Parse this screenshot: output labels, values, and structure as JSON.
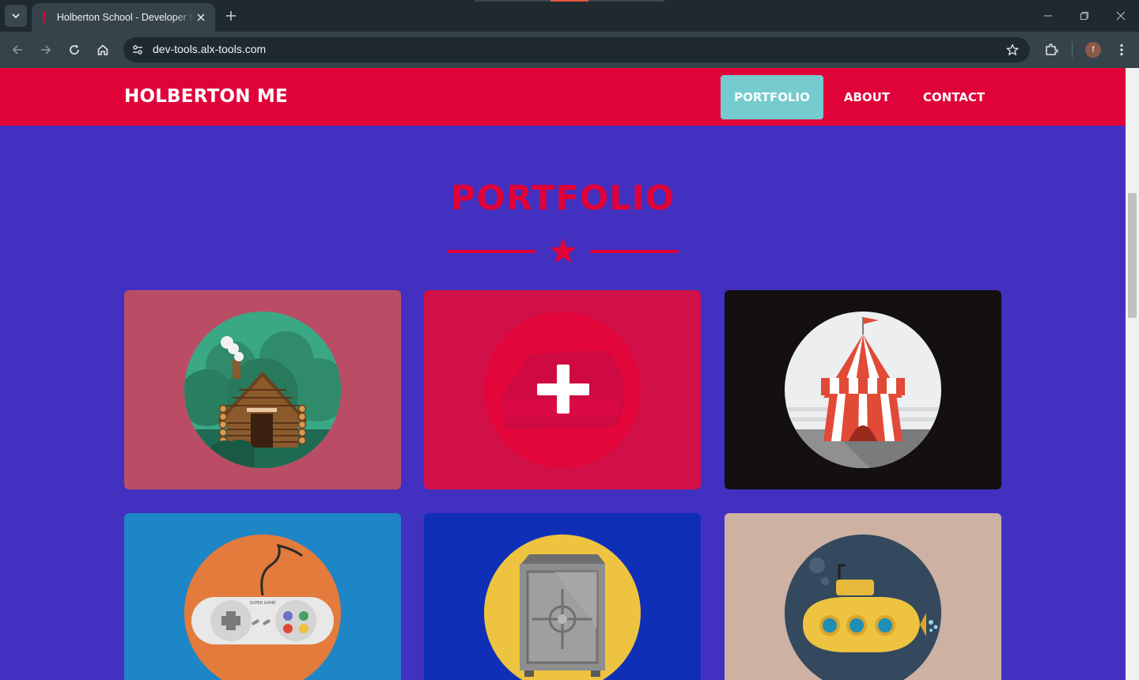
{
  "browser": {
    "tab_title": "Holberton School - Developer tools",
    "address": "dev-tools.alx-tools.com"
  },
  "site": {
    "brand": "HOLBERTON ME",
    "nav": [
      {
        "label": "PORTFOLIO",
        "active": true
      },
      {
        "label": "ABOUT",
        "active": false
      },
      {
        "label": "CONTACT",
        "active": false
      }
    ],
    "avatar_initial": "f"
  },
  "portfolio": {
    "title": "PORTFOLIO",
    "items": [
      {
        "name": "cabin",
        "icon": "log-cabin-icon",
        "bg": "#ba4d65",
        "circle": "#2f9a7a"
      },
      {
        "name": "add",
        "icon": "plus-icon",
        "bg": "#d11049",
        "circle": "#e2063b"
      },
      {
        "name": "circus",
        "icon": "circus-tent-icon",
        "bg": "#140f10",
        "circle": "#eceeef"
      },
      {
        "name": "game",
        "icon": "game-controller-icon",
        "bg": "#1e85c6",
        "circle": "#e27b3b",
        "controller_text": "SUPER GAME"
      },
      {
        "name": "safe",
        "icon": "safe-icon",
        "bg": "#0f30b6",
        "circle": "#eec33f"
      },
      {
        "name": "submarine",
        "icon": "submarine-icon",
        "bg": "#cdb1a3",
        "circle": "#34495e"
      }
    ]
  },
  "colors": {
    "header": "#e0033a",
    "page_bg": "#4231c0",
    "nav_active": "#76cbcf"
  }
}
